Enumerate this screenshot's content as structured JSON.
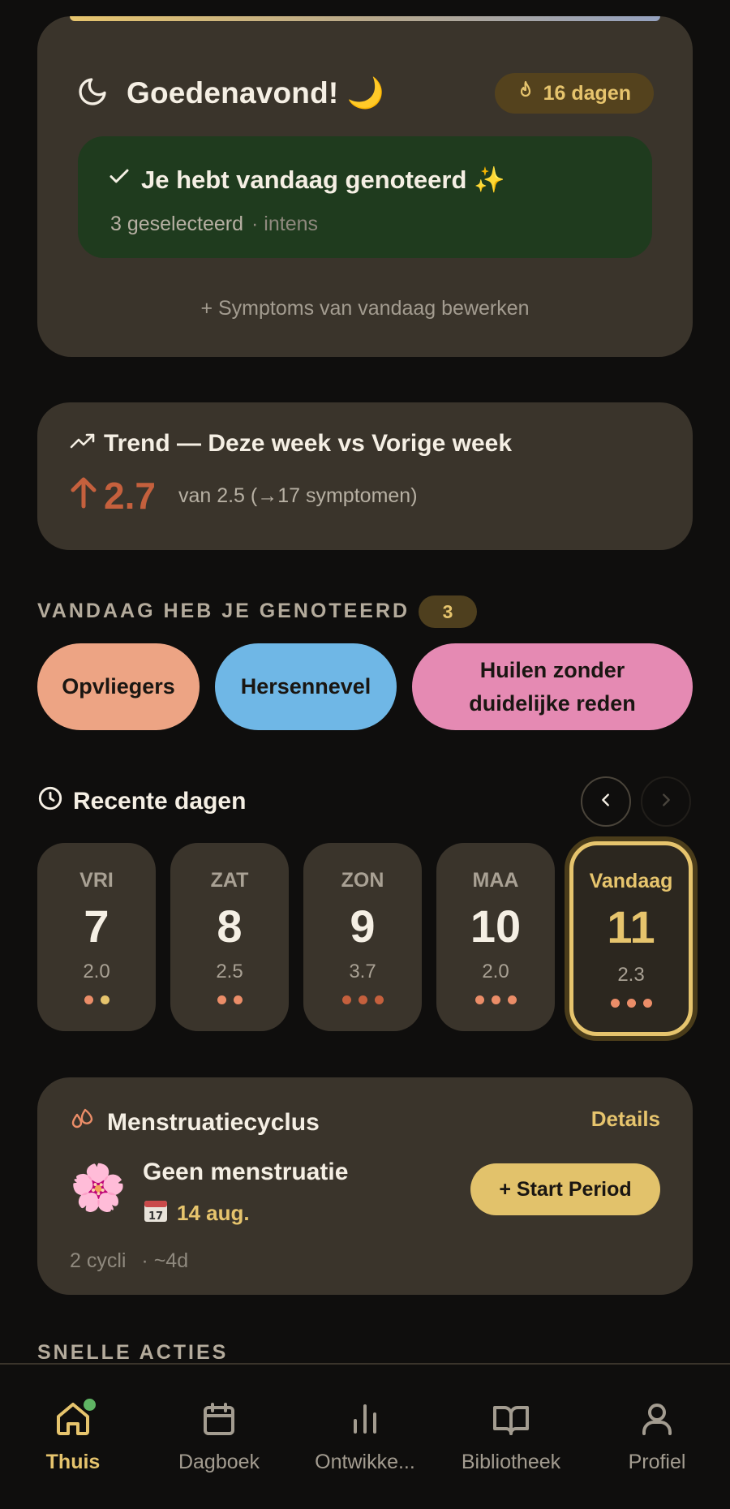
{
  "greeting": {
    "title": "Goedenavond! 🌙",
    "streak": "16 dagen",
    "logged_title": "Je hebt vandaag genoteerd ✨",
    "logged_count": "3 geselecteerd",
    "logged_intensity": "· intens",
    "edit_link": "+ Symptoms van vandaag bewerken"
  },
  "trend": {
    "title": "Trend — Deze week vs Vorige week",
    "value": "2.7",
    "detail": "van 2.5 (→17 symptomen)"
  },
  "today_logged": {
    "label": "VANDAAG HEB JE GENOTEERD",
    "count": "3",
    "chips": [
      {
        "label": "Opvliegers",
        "color": "#eda484"
      },
      {
        "label": "Hersennevel",
        "color": "#6fb7e6"
      },
      {
        "label": "Huilen zonder duidelijke reden",
        "color": "#e58ab3"
      }
    ]
  },
  "recent": {
    "title": "Recente dagen",
    "days": [
      {
        "name": "VRI",
        "num": "7",
        "score": "2.0",
        "dots": 2
      },
      {
        "name": "ZAT",
        "num": "8",
        "score": "2.5",
        "dots": 2
      },
      {
        "name": "ZON",
        "num": "9",
        "score": "3.7",
        "dots": 3
      },
      {
        "name": "MAA",
        "num": "10",
        "score": "2.0",
        "dots": 3
      },
      {
        "name": "Vandaag",
        "num": "11",
        "score": "2.3",
        "dots": 3
      }
    ]
  },
  "cycle": {
    "title": "Menstruatiecyclus",
    "details": "Details",
    "status": "Geen menstruatie",
    "date": "14 aug.",
    "start_button": "+ Start Period",
    "meta": "2 cycli",
    "meta_sub": "· ~4d"
  },
  "quick_actions": {
    "label": "SNELLE ACTIES"
  },
  "nav": {
    "items": [
      {
        "label": "Thuis"
      },
      {
        "label": "Dagboek"
      },
      {
        "label": "Ontwikke..."
      },
      {
        "label": "Bibliotheek"
      },
      {
        "label": "Profiel"
      }
    ]
  },
  "colors": {
    "accent": "#e6c46d",
    "card": "#3a342b",
    "background": "#0f0e0d",
    "trend_up": "#c5603d"
  }
}
